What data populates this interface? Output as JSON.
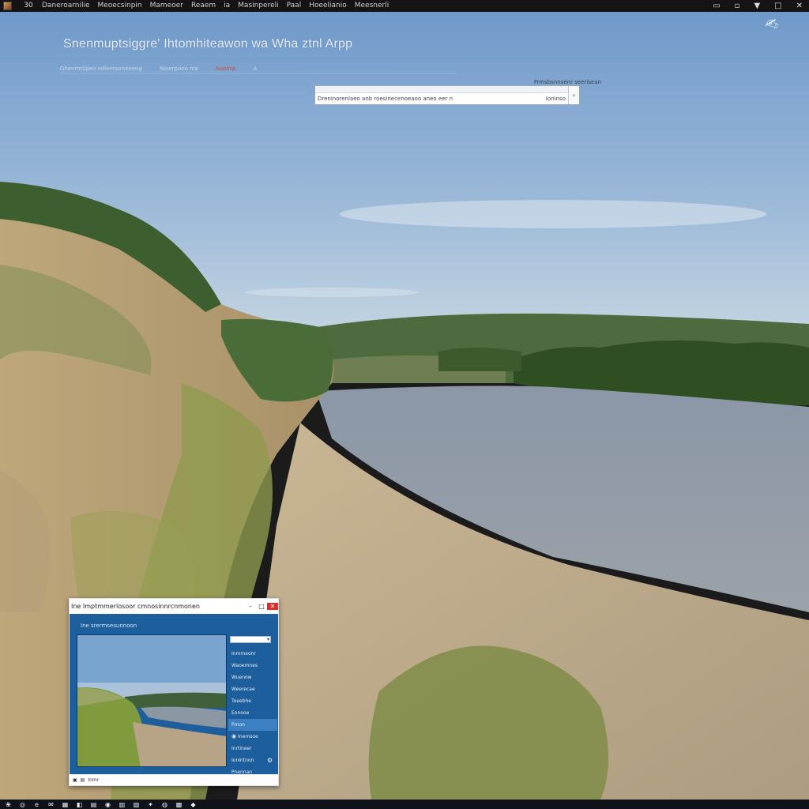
{
  "topbar": {
    "number": "30",
    "menus": [
      "Daneroarnilie",
      "Meoecsinpin",
      "Mameoer",
      "Reaem",
      "ia",
      "Masinpereli",
      "Paal",
      "Hoeelianio",
      "Meesnerli"
    ],
    "icons": [
      "app-icon",
      "minimize-icon",
      "restore-icon",
      "dropdown-icon",
      "maximize-icon",
      "close-icon"
    ]
  },
  "desktop": {
    "heading": "Snenmuptsiggre' Ihtomhiteawon wa Wha ztnl Arpp",
    "links": [
      "Ghenmrllpeo odienrsoneoeng",
      "Nioerpoeo nia",
      "Aoomw",
      "A"
    ],
    "corner_logo": "✍",
    "search": {
      "hint": "Frmsbsnnsenr seerisean",
      "value": "Dreninorenlaeo anb roesinecenoeaoo aneo eer n",
      "right_text": "Ioninso",
      "go": "›"
    }
  },
  "mini_window": {
    "title": "Ine Imptmmerlosoor cmnosinnrcnmonen",
    "controls": {
      "minimize": "–",
      "maximize": "□",
      "close": "✕"
    },
    "subhead": "Ine srermsesunnoon",
    "side_field": "",
    "side_options": [
      "Inmmeonr",
      "Waoemnes",
      "Wuenow",
      "Weerecae",
      "Toeebhe",
      "Eonooe",
      "Pmon",
      "Inemsoe",
      "Inrtineer",
      "Ionintnon",
      "Pnennan"
    ],
    "status": [
      "▣",
      "▤",
      "Inmr"
    ]
  },
  "taskbar": {
    "icons": [
      "start-icon",
      "search-icon",
      "edge-icon",
      "mail-icon",
      "store-icon",
      "photos-icon",
      "folder-icon",
      "settings-icon",
      "chat-icon",
      "files-icon",
      "chrome-icon",
      "terminal-icon",
      "explorer-icon",
      "app-icon"
    ],
    "glyphs": [
      "❀",
      "◎",
      "e",
      "✉",
      "▦",
      "◧",
      "▤",
      "◉",
      "▥",
      "▧",
      "✦",
      "◍",
      "▩",
      "◆"
    ]
  },
  "colors": {
    "sky_top": "#6f99cb",
    "sky_bottom": "#bcd0e0",
    "window_blue": "#1d5e9c",
    "close_red": "#d8302a"
  }
}
